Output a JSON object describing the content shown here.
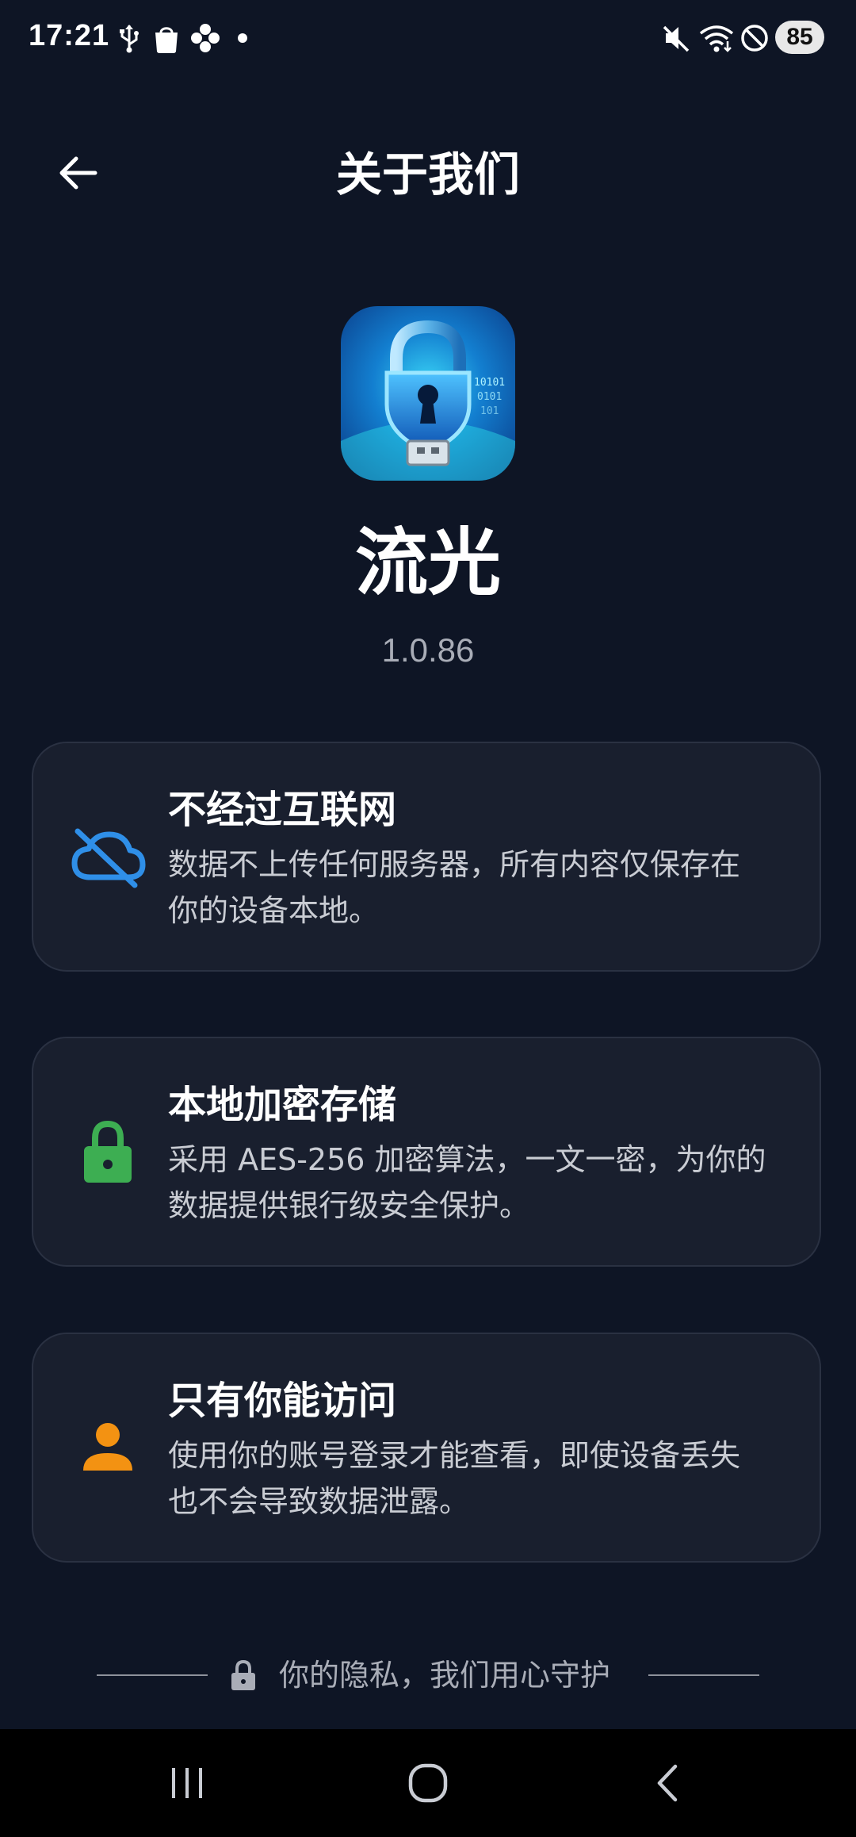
{
  "status_bar": {
    "time": "17:21",
    "left_icons": [
      "usb-icon",
      "shopping-bag-icon",
      "flower-icon",
      "dot-icon"
    ],
    "right_icons": [
      "mute-icon",
      "wifi-icon",
      "do-not-disturb-icon"
    ],
    "battery": "85"
  },
  "header": {
    "title": "关于我们",
    "back_icon": "arrow-left-icon"
  },
  "app": {
    "name": "流光",
    "version": "1.0.86",
    "icon": "usb-shield-lock-app-icon"
  },
  "features": [
    {
      "icon": "cloud-off-icon",
      "icon_color": "#2f8fe8",
      "title": "不经过互联网",
      "line1": "数据不上传任何服务器，所有内容仅保存在",
      "line2": "你的设备本地。"
    },
    {
      "icon": "lock-icon",
      "icon_color": "#3dae52",
      "title": "本地加密存储",
      "line1": "采用 AES-256 加密算法，一文一密，为你的",
      "line2": "数据提供银行级安全保护。"
    },
    {
      "icon": "person-icon",
      "icon_color": "#f39212",
      "title": "只有你能访问",
      "line1": "使用你的账号登录才能查看，即使设备丢失",
      "line2": "也不会导致数据泄露。"
    }
  ],
  "footer": {
    "text": "你的隐私，我们用心守护",
    "icon": "lock-icon"
  },
  "nav_bar": {
    "recents_icon": "recent-apps-icon",
    "home_icon": "home-icon",
    "back_icon": "nav-back-icon"
  }
}
